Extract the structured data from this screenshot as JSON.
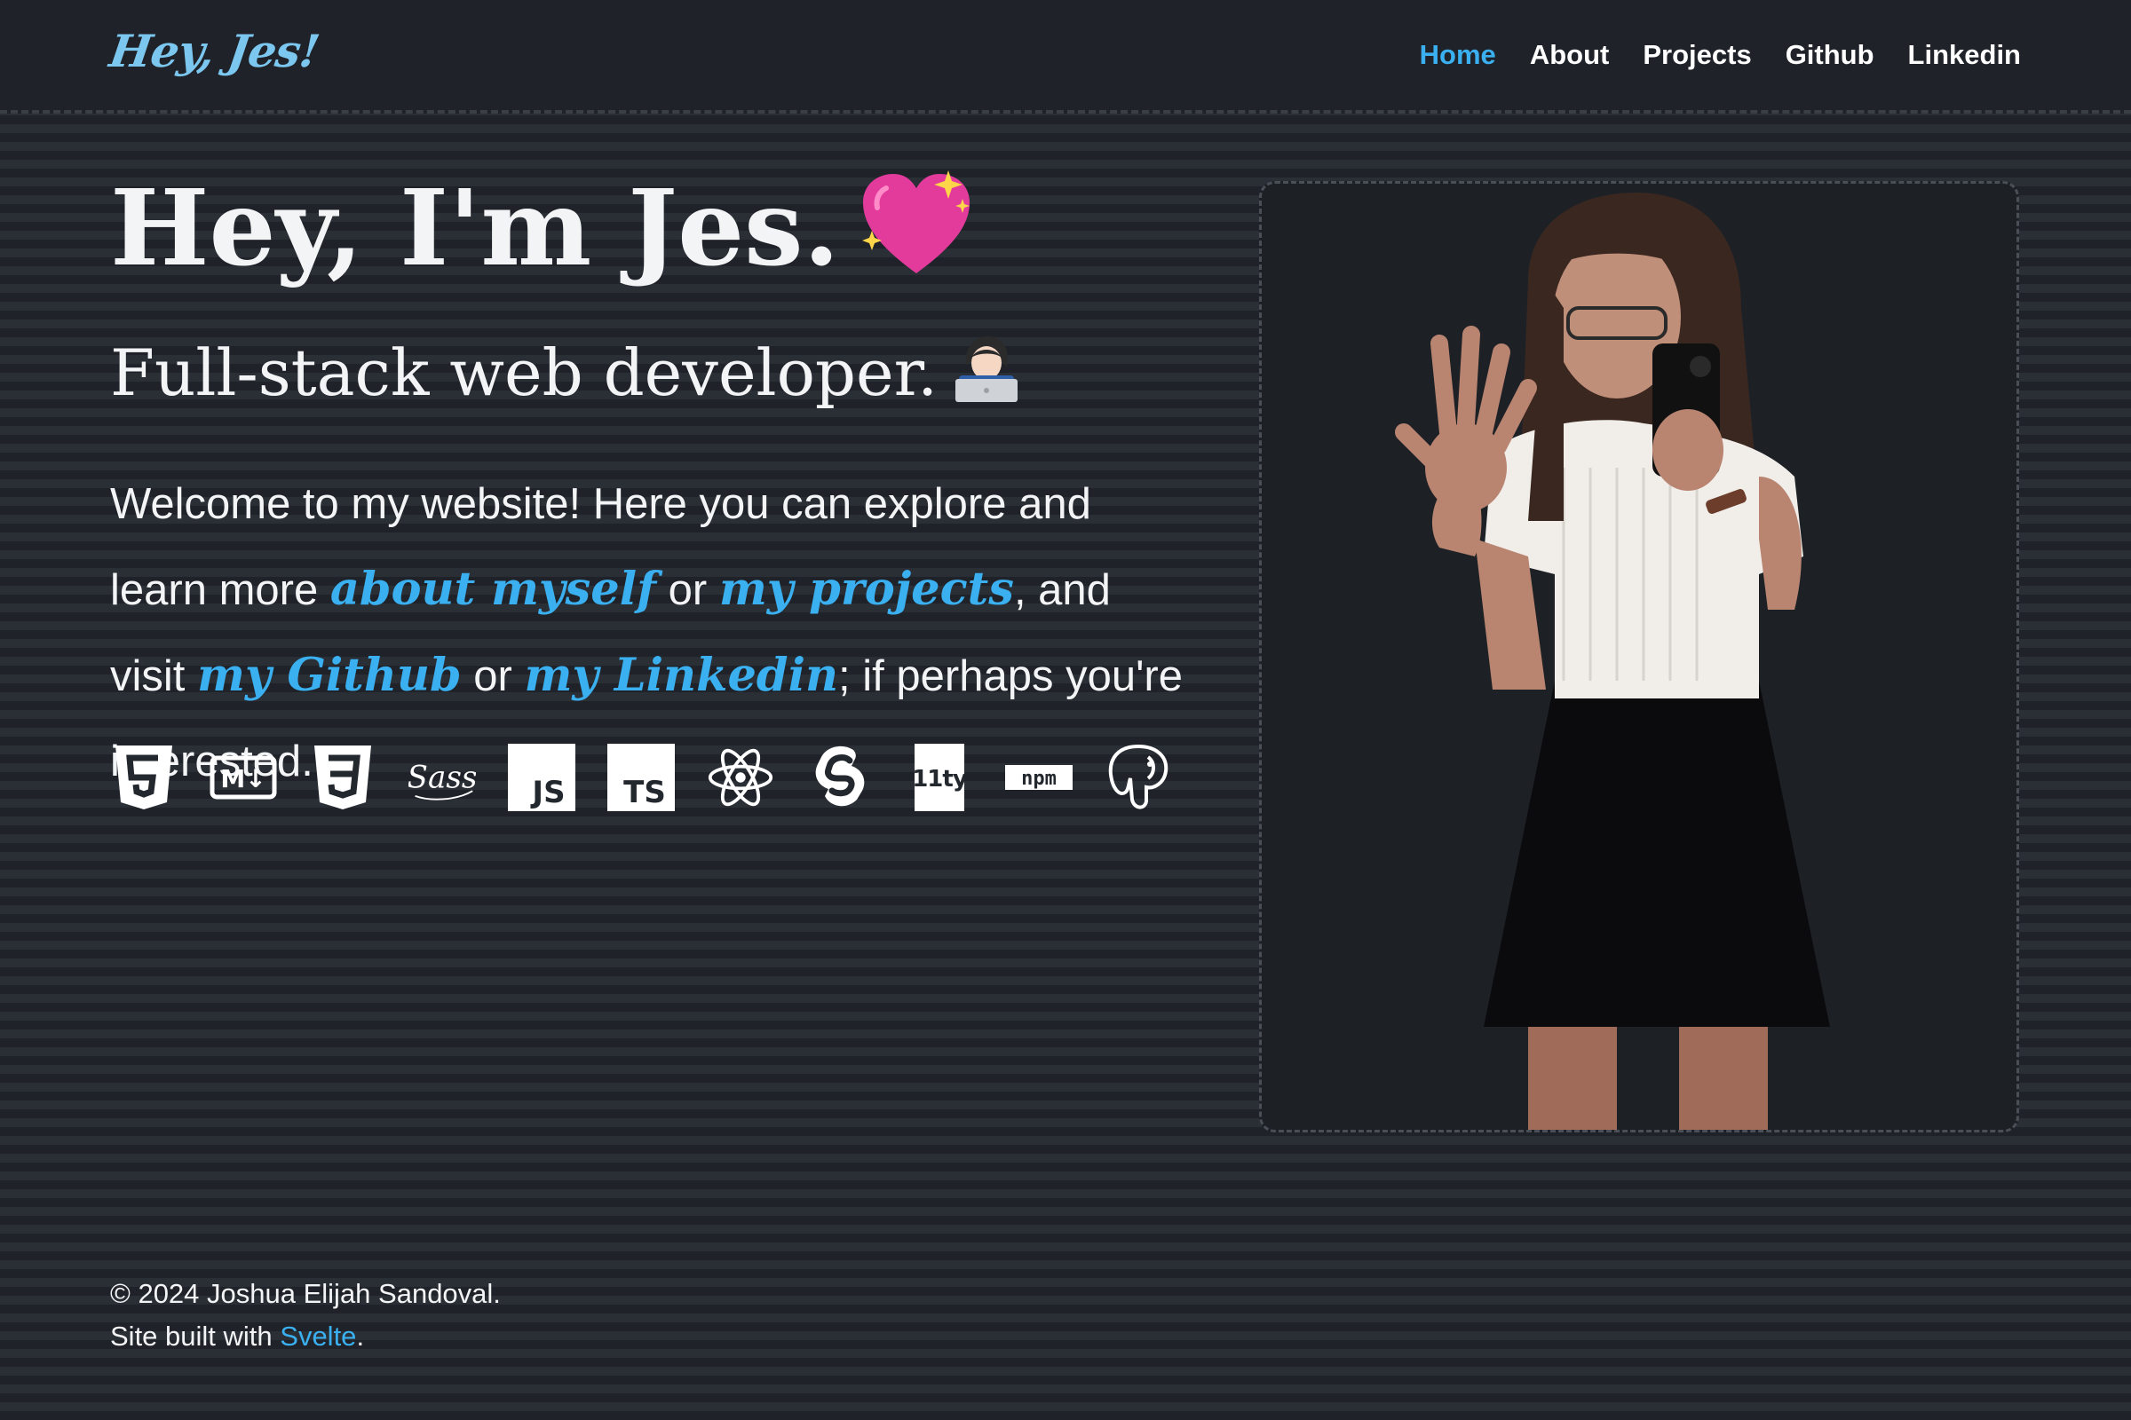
{
  "header": {
    "brand": "Hey, Jes!",
    "nav": [
      {
        "label": "Home",
        "active": true
      },
      {
        "label": "About",
        "active": false
      },
      {
        "label": "Projects",
        "active": false
      },
      {
        "label": "Github",
        "active": false
      },
      {
        "label": "Linkedin",
        "active": false
      }
    ]
  },
  "hero": {
    "title": "Hey, I'm Jes.",
    "title_icon": "sparkling-heart-icon",
    "subtitle": "Full-stack web developer.",
    "subtitle_icon": "technologist-icon",
    "intro": {
      "part1": "Welcome to my website! Here you can explore and learn more ",
      "link_about": "about myself",
      "part2": " or ",
      "link_projects": "my projects",
      "part3": ", and visit ",
      "link_github": "my Github",
      "part4": " or ",
      "link_linkedin": "my Linkedin",
      "part5": "; if perhaps you're interested."
    },
    "tech_icons": [
      "html5-icon",
      "markdown-icon",
      "css3-icon",
      "sass-icon",
      "javascript-icon",
      "typescript-icon",
      "react-icon",
      "svelte-icon",
      "eleventy-icon",
      "npm-icon",
      "postgresql-icon"
    ],
    "tech_labels": {
      "md": "M↓",
      "sass": "Sass",
      "js": "JS",
      "ts": "TS",
      "eleventy": "11ty",
      "npm": "npm"
    },
    "photo": "portrait-photo"
  },
  "footer": {
    "copyright": "© 2024 Joshua Elijah Sandoval.",
    "built_prefix": "Site built with ",
    "built_link": "Svelte",
    "built_suffix": "."
  },
  "colors": {
    "accent": "#3bb0f0",
    "background": "#23272e",
    "text": "#f3f4f6"
  }
}
